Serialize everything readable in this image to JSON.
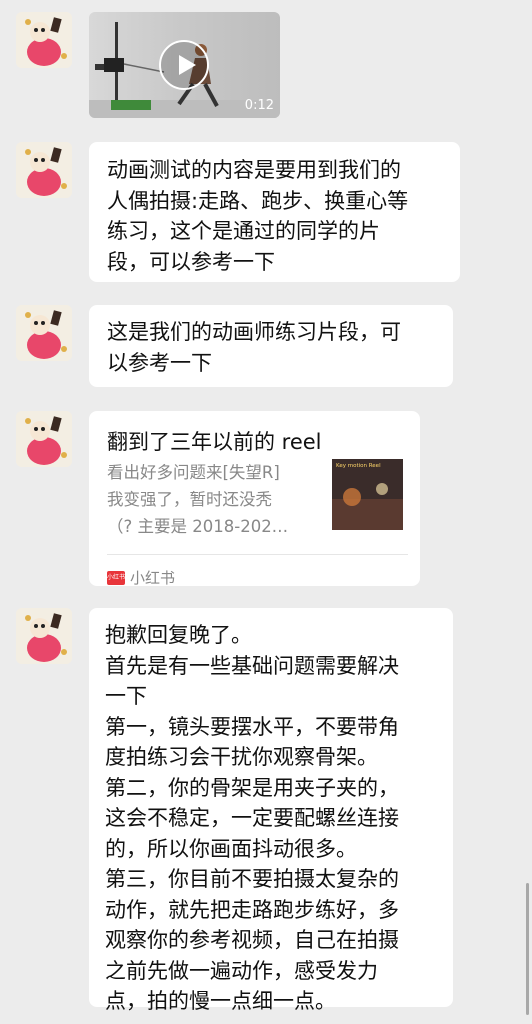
{
  "video_message": {
    "duration": "0:12"
  },
  "messages": [
    {
      "lines": [
        "动画测试的内容是要用到我们的",
        "人偶拍摄:走路、跑步、换重心等",
        "练习，这个是通过的同学的片",
        "段，可以参考一下"
      ]
    },
    {
      "lines": [
        "这是我们的动画师练习片段，可",
        "以参考一下"
      ]
    }
  ],
  "link_card": {
    "title": "翻到了三年以前的 reel",
    "desc_lines": [
      "看出好多问题来[失望R]",
      "我变强了，暂时还没秃",
      "（? 主要是 2018-202…"
    ],
    "thumb_text": "Key motion Reel",
    "source_logo_text": "小红书",
    "source_label": "小红书"
  },
  "last_message": {
    "lines": [
      "抱歉回复晚了。",
      "首先是有一些基础问题需要解决",
      "一下",
      "第一，镜头要摆水平，不要带角",
      "度拍练习会干扰你观察骨架。",
      "第二，你的骨架是用夹子夹的，",
      "这会不稳定，一定要配螺丝连接",
      "的，所以你画面抖动很多。",
      "第三，你目前不要拍摄太复杂的",
      "动作，就先把走路跑步练好，多",
      "观察你的参考视频，自己在拍摄",
      "之前先做一遍动作，感受发力",
      "点，拍的慢一点细一点。"
    ]
  },
  "colors": {
    "background": "#ececec",
    "bubble": "#ffffff",
    "text": "#111111",
    "muted": "#888888",
    "brand_xhs": "#e8353a"
  }
}
